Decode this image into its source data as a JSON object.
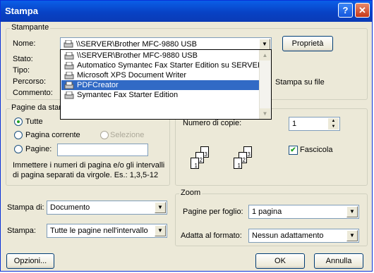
{
  "window": {
    "title": "Stampa",
    "help_glyph": "?",
    "close_glyph": "✕"
  },
  "printer": {
    "legend": "Stampante",
    "name_label": "Nome:",
    "name_value": "\\\\SERVER\\Brother MFC-9880 USB",
    "properties_button": "Proprietà",
    "status_label": "Stato:",
    "type_label": "Tipo:",
    "path_label": "Percorso:",
    "comment_label": "Commento:",
    "print_to_file_label": "Stampa su file",
    "dropdown_options": [
      "\\\\SERVER\\Brother MFC-9880 USB",
      "Automatico Symantec Fax Starter Edition su SERVER",
      "Microsoft XPS Document Writer",
      "PDFCreator",
      "Symantec Fax Starter Edition"
    ],
    "highlighted_index": 3
  },
  "pages": {
    "legend": "Pagine da stam",
    "all_label": "Tutte",
    "current_label": "Pagina corrente",
    "selection_label": "Selezione",
    "pages_label": "Pagine:",
    "pages_value": "",
    "help_line1": "Immettere i numeri di pagina e/o gli intervalli",
    "help_line2": "di pagina separati da virgole. Es.: 1,3,5-12"
  },
  "copies": {
    "count_label": "Numero di copie:",
    "count_value": "1",
    "collate_label": "Fascicola",
    "collate_checked": true,
    "page_numbers": [
      "3",
      "2",
      "1"
    ]
  },
  "print_what": {
    "label": "Stampa di:",
    "value": "Documento"
  },
  "print_range": {
    "label": "Stampa:",
    "value": "Tutte le pagine nell'intervallo"
  },
  "zoom": {
    "legend": "Zoom",
    "pages_per_sheet_label": "Pagine per foglio:",
    "pages_per_sheet_value": "1 pagina",
    "scale_label": "Adatta al formato:",
    "scale_value": "Nessun adattamento"
  },
  "buttons": {
    "options": "Opzioni...",
    "ok": "OK",
    "cancel": "Annulla"
  }
}
